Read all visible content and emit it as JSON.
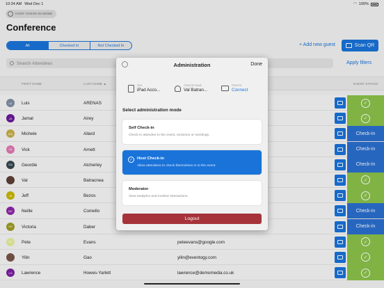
{
  "status_bar": {
    "time": "10:34 AM",
    "date": "Wed Dec 1",
    "battery": "100%"
  },
  "mode_pill": {
    "label": "HOST CHECK-IN MODE"
  },
  "page": {
    "title": "Conference"
  },
  "filters": {
    "tabs": [
      "All",
      "Checked In",
      "Not Checked In"
    ]
  },
  "actions": {
    "add_guest": "+ Add new guest",
    "scan_qr": "Scan QR",
    "apply_filters": "Apply filters"
  },
  "search": {
    "placeholder": "Search Attendees"
  },
  "table": {
    "headers": {
      "first": "FIRST NAME",
      "last": "LAST NAME ▲",
      "status": "EVENT STATUS"
    },
    "rows": [
      {
        "initials": "LA",
        "color": "#7e8fa3",
        "first": "Luis",
        "last": "ARENAS",
        "email": "",
        "checked_in": true
      },
      {
        "initials": "JA",
        "color": "#6a1b9a",
        "first": "Jamal",
        "last": "Airey",
        "email": "",
        "checked_in": true
      },
      {
        "initials": "MA",
        "color": "#c8b04a",
        "first": "Michele",
        "last": "Allard",
        "email": "",
        "checked_in": false
      },
      {
        "initials": "VA",
        "color": "#e07ab4",
        "first": "Vick",
        "last": "Arnett",
        "email": "",
        "checked_in": false
      },
      {
        "initials": "GA",
        "color": "#37474f",
        "first": "Geordie",
        "last": "Atcherley",
        "email": "",
        "checked_in": false
      },
      {
        "initials": "",
        "color": "#5d4037",
        "first": "Val",
        "last": "Batracnea",
        "email": "",
        "checked_in": true
      },
      {
        "initials": "JB",
        "color": "#c7b800",
        "first": "Jeff",
        "last": "Bezos",
        "email": "",
        "checked_in": true
      },
      {
        "initials": "NC",
        "color": "#8e24aa",
        "first": "Neille",
        "last": "Comello",
        "email": "",
        "checked_in": false
      },
      {
        "initials": "VD",
        "color": "#9e9d24",
        "first": "Victoria",
        "last": "Daber",
        "email": "",
        "checked_in": false
      },
      {
        "initials": "PE",
        "color": "#e6ee9c",
        "first": "Pete",
        "last": "Evans",
        "email": "peteevans@google.com",
        "checked_in": true
      },
      {
        "initials": "",
        "color": "#795548",
        "first": "Yilin",
        "last": "Gao",
        "email": "yilin@eventogy.com",
        "checked_in": true
      },
      {
        "initials": "LH",
        "color": "#7b1fa2",
        "first": "Lawrence",
        "last": "Howes-Yarlett",
        "email": "lawrence@demomedia.co.uk",
        "checked_in": true
      }
    ],
    "status_labels": {
      "check_in": "Check-in",
      "checked_mark": "✓"
    }
  },
  "modal": {
    "title": "Administration",
    "done": "Done",
    "device": {
      "caption": "iPAD",
      "value": "iPad Acco..."
    },
    "user": {
      "caption": "CREATOR NAME",
      "value": "Val Batran..."
    },
    "printer": {
      "caption": "PRINTER",
      "value": "Connect"
    },
    "select_mode": "Select administration mode",
    "modes": [
      {
        "title": "Self Check-in",
        "desc": "Check in attendee to the event, sessions or meetings."
      },
      {
        "title": "Host Check-in",
        "desc": "Allow attendees to check themselves in to the event."
      },
      {
        "title": "Moderator",
        "desc": "View analytics and monitor interactions."
      }
    ],
    "logout": "Logout"
  }
}
